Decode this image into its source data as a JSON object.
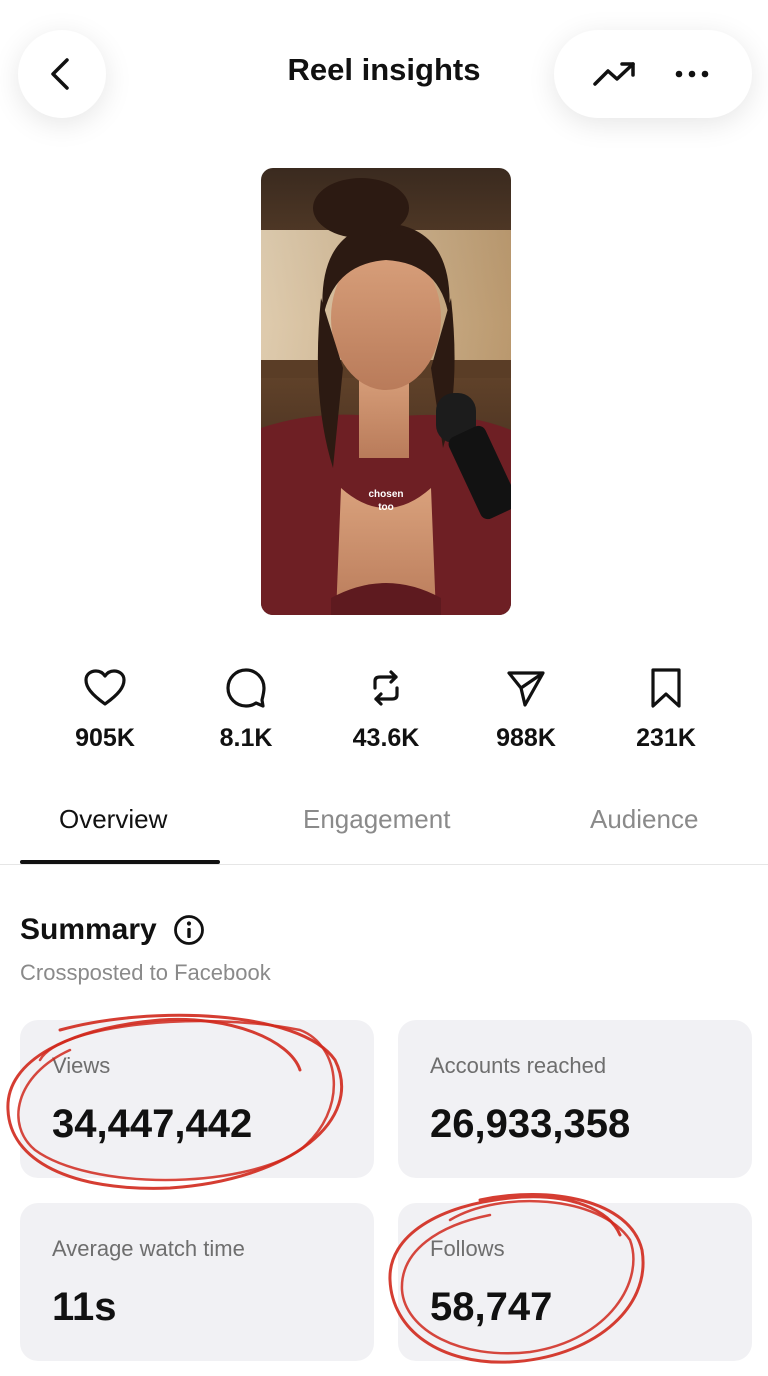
{
  "header": {
    "title": "Reel insights"
  },
  "icons": {
    "back": "chevron-left-icon",
    "trend": "trending-up-icon",
    "more": "more-horizontal-icon"
  },
  "reel": {
    "caption_line1": "chosen",
    "caption_line2": "too"
  },
  "stats": [
    {
      "icon": "heart-icon",
      "value": "905K"
    },
    {
      "icon": "comment-icon",
      "value": "8.1K"
    },
    {
      "icon": "repost-icon",
      "value": "43.6K"
    },
    {
      "icon": "share-icon",
      "value": "988K"
    },
    {
      "icon": "bookmark-icon",
      "value": "231K"
    }
  ],
  "tabs": [
    {
      "label": "Overview",
      "active": true
    },
    {
      "label": "Engagement",
      "active": false
    },
    {
      "label": "Audience",
      "active": false
    }
  ],
  "summary": {
    "title": "Summary",
    "subtitle": "Crossposted to Facebook",
    "cards": [
      {
        "label": "Views",
        "value": "34,447,442"
      },
      {
        "label": "Accounts reached",
        "value": "26,933,358"
      },
      {
        "label": "Average watch time",
        "value": "11s"
      },
      {
        "label": "Follows",
        "value": "58,747"
      }
    ]
  },
  "colors": {
    "annotation": "#d0281c",
    "card_bg": "#f1f1f4",
    "muted_text": "#8a8a8a"
  }
}
